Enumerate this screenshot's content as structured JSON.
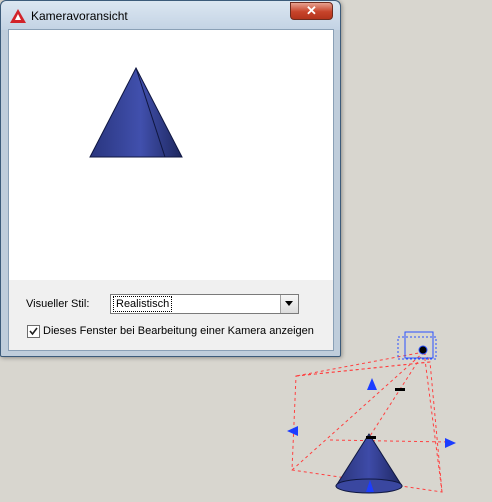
{
  "window": {
    "title": "Kameravoransicht",
    "icon": "autocad-icon",
    "close_icon": "close-icon"
  },
  "visual_style": {
    "label": "Visueller Stil:",
    "selected": "Realistisch"
  },
  "show_window_checkbox": {
    "label": "Dieses Fenster bei Bearbeitung einer Kamera anzeigen",
    "checked": true
  },
  "colors": {
    "object_fill": "#303c8a",
    "camera_frustum": "#ff4b4b",
    "camera_glyph": "#2a50ff",
    "grip": "#1c3dff"
  }
}
